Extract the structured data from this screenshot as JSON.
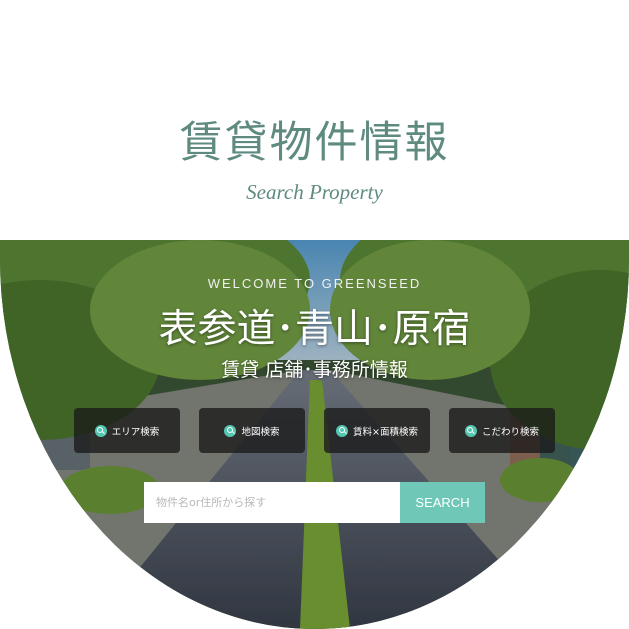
{
  "section": {
    "title": "賃貸物件情報",
    "subtitle": "Search Property"
  },
  "hero": {
    "welcome": "WELCOME TO GREENSEED",
    "heading": "表参道･青山･原宿",
    "subheading": "賃貸 店舗･事務所情報"
  },
  "search_buttons": [
    {
      "label": "エリア検索",
      "icon": "search-icon"
    },
    {
      "label": "地図検索",
      "icon": "search-icon"
    },
    {
      "label": "賃料×面積検索",
      "icon": "search-icon"
    },
    {
      "label": "こだわり検索",
      "icon": "search-icon"
    }
  ],
  "search": {
    "placeholder": "物件名or住所から探す",
    "value": "",
    "button_label": "SEARCH"
  },
  "colors": {
    "title": "#5e8a80",
    "accent": "#6fc7b7",
    "button_bg": "#191919"
  }
}
